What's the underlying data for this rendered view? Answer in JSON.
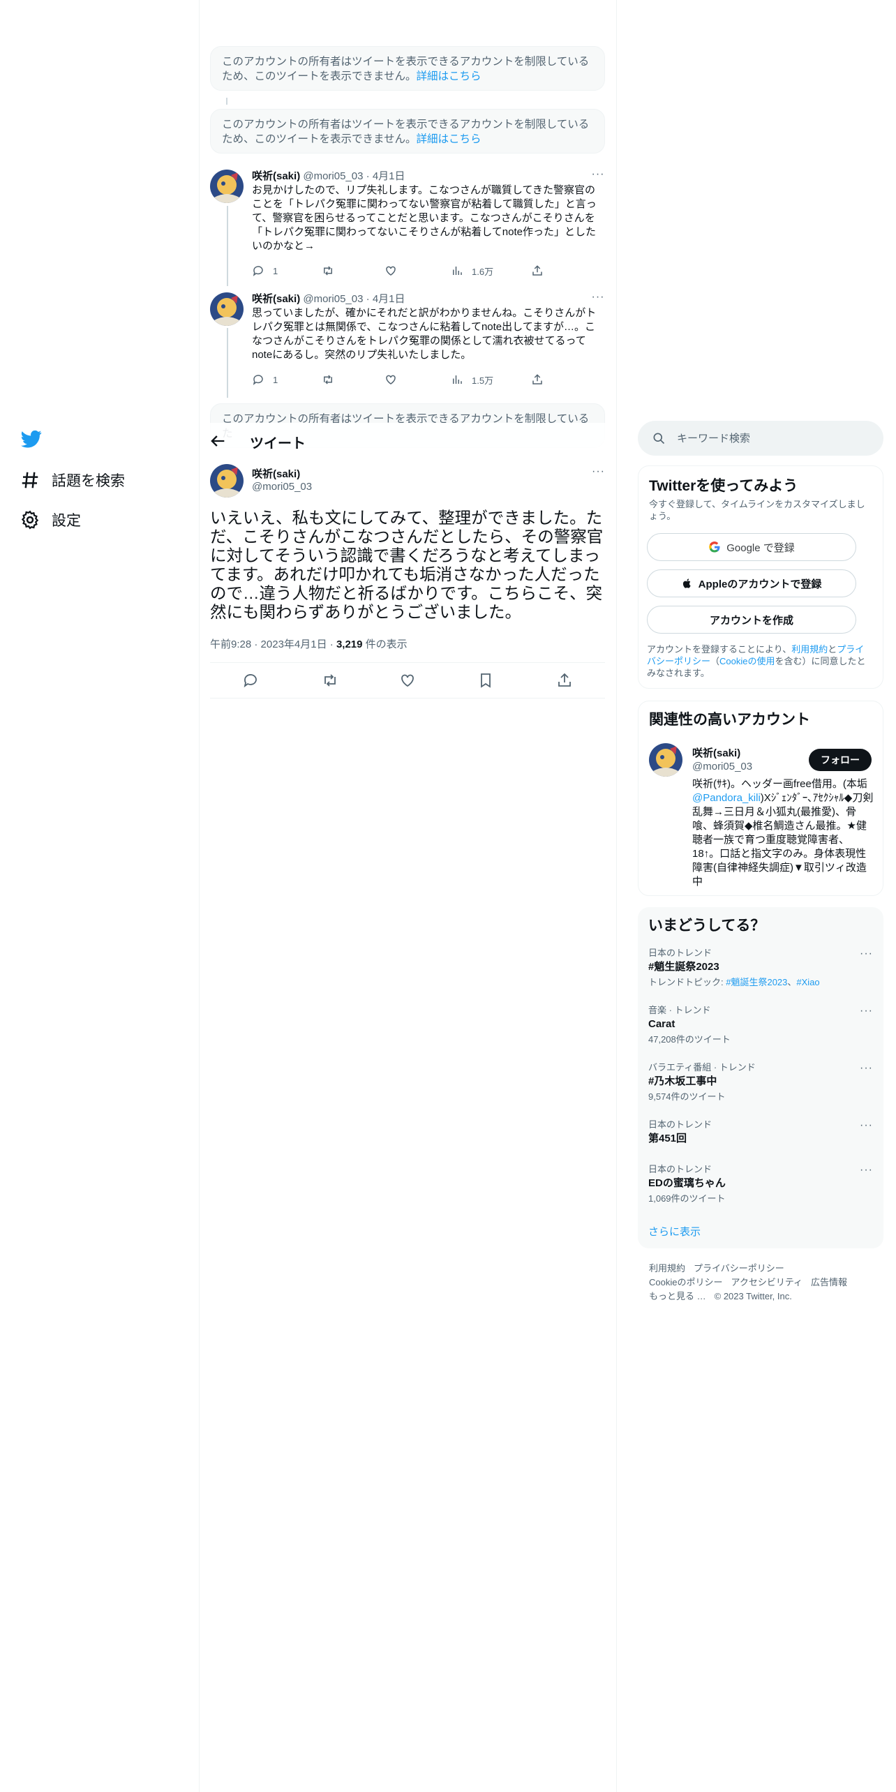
{
  "nav": {
    "explore": "話題を検索",
    "settings": "設定"
  },
  "restricted": {
    "message": "このアカウントの所有者はツイートを表示できるアカウントを制限しているため、このツイートを表示できません。",
    "link": "詳細はこちら",
    "message_cut": "このアカウントの所有者はツイートを表示できるアカウントを制限しているた"
  },
  "replies": [
    {
      "name": "咲祈(saki)",
      "handle": "@mori05_03",
      "sep": "·",
      "date": "4月1日",
      "text": "お見かけしたので、リプ失礼します。こなつさんが職質してきた警察官のことを「トレパク冤罪に関わってない警察官が粘着して職質した」と言って、警察官を困らせるってことだと思います。こなつさんがこそりさんを「トレパク冤罪に関わってないこそりさんが粘着してnote作った」としたいのかなと→",
      "reply_count": "1",
      "views": "1.6万"
    },
    {
      "name": "咲祈(saki)",
      "handle": "@mori05_03",
      "sep": "·",
      "date": "4月1日",
      "text": "思っていましたが、確かにそれだと訳がわかりませんね。こそりさんがトレパク冤罪とは無関係で、こなつさんに粘着してnote出してますが…。こなつさんがこそりさんをトレパク冤罪の関係として濡れ衣被せてるってnoteにあるし。突然のリプ失礼いたしました。",
      "reply_count": "1",
      "views": "1.5万"
    }
  ],
  "header": {
    "title": "ツイート"
  },
  "focal": {
    "name": "咲祈(saki)",
    "handle": "@mori05_03",
    "text": "いえいえ、私も文にしてみて、整理ができました。ただ、こそりさんがこなつさんだとしたら、その警察官に対してそういう認識で書くだろうなと考えてしまってます。あれだけ叩かれても垢消さなかった人だったので…違う人物だと祈るばかりです。こちらこそ、突然にも関わらずありがとうございました。",
    "time": "午前9:28",
    "dot": "·",
    "date": "2023年4月1日",
    "views_count": "3,219",
    "views_label": " 件の表示"
  },
  "search": {
    "placeholder": "キーワード検索"
  },
  "signup": {
    "title": "Twitterを使ってみよう",
    "subtitle": "今すぐ登録して、タイムラインをカスタマイズしましょう。",
    "google_btn": "Google で登録",
    "apple_btn": "Appleのアカウントで登録",
    "create_btn": "アカウントを作成",
    "legal_pre": "アカウントを登録することにより、",
    "legal_terms": "利用規約",
    "legal_mid": "と",
    "legal_privacy": "プライバシーポリシー",
    "legal_open": "（",
    "legal_cookie": "Cookieの使用",
    "legal_post": "を含む）に同意したとみなされます。"
  },
  "related": {
    "title": "関連性の高いアカウント",
    "name": "咲祈(saki)",
    "handle": "@mori05_03",
    "follow": "フォロー",
    "bio_pre": "咲祈(ｻｷ)。ヘッダー画free借用。(本垢",
    "bio_link": "@Pandora_kili",
    "bio_post": ")Xｼﾞｪﾝﾀﾞｰ､ｱｾｸｼｬﾙ◆刀剣乱舞→三日月＆小狐丸(最推愛)、骨喰、蜂須賀◆椎名鯛造さん最推。★健聴者一族で育つ重度聴覚障害者、18↑。口話と指文字のみ。身体表現性障害(自律神経失調症)▼取引ツィ改造中"
  },
  "trends": {
    "title": "いまどうしてる？",
    "items": [
      {
        "category": "日本のトレンド",
        "name": "#魈生誕祭2023",
        "sub_pre": "トレンドトピック: ",
        "sub_link1": "#魈誕生祭2023",
        "sub_sep": "、",
        "sub_link2": "#Xiao"
      },
      {
        "category": "音楽 · トレンド",
        "name": "Carat",
        "sub": "47,208件のツイート"
      },
      {
        "category": "バラエティ番組 · トレンド",
        "name": "#乃木坂工事中",
        "sub": "9,574件のツイート"
      },
      {
        "category": "日本のトレンド",
        "name": "第451回"
      },
      {
        "category": "日本のトレンド",
        "name": "EDの蜜璃ちゃん",
        "sub": "1,069件のツイート"
      }
    ],
    "show_more": "さらに表示"
  },
  "footer": {
    "terms": "利用規約",
    "privacy": "プライバシーポリシー",
    "cookie": "Cookieのポリシー",
    "accessibility": "アクセシビリティ",
    "ads": "広告情報",
    "more": "もっと見る …",
    "copyright": "© 2023 Twitter, Inc."
  },
  "colors": {
    "accent": "#1d9bf0",
    "text": "#0f1419",
    "muted": "#536471"
  }
}
